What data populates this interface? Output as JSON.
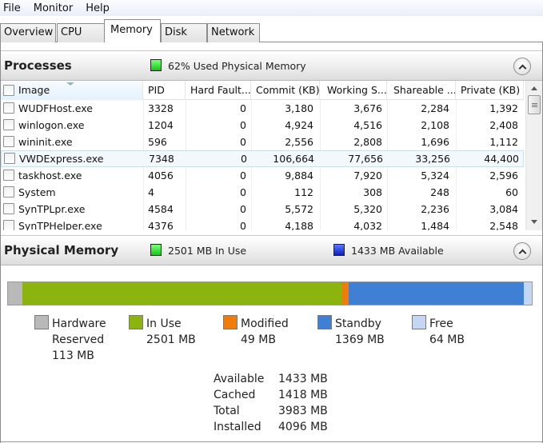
{
  "menu": [
    "File",
    "Monitor",
    "Help"
  ],
  "tabs": [
    {
      "label": "Overview",
      "active": false
    },
    {
      "label": "CPU",
      "active": false
    },
    {
      "label": "Memory",
      "active": true
    },
    {
      "label": "Disk",
      "active": false
    },
    {
      "label": "Network",
      "active": false
    }
  ],
  "processes": {
    "title": "Processes",
    "summary": "62% Used Physical Memory",
    "columns": [
      "Image",
      "PID",
      "Hard Fault...",
      "Commit (KB)",
      "Working S...",
      "Shareable ...",
      "Private (KB)"
    ],
    "rows": [
      {
        "image": "WUDFHost.exe",
        "pid": "3328",
        "hard_faults": "0",
        "commit": "3,180",
        "working_set": "3,676",
        "shareable": "2,284",
        "private": "1,392",
        "selected": false
      },
      {
        "image": "winlogon.exe",
        "pid": "1204",
        "hard_faults": "0",
        "commit": "4,924",
        "working_set": "4,516",
        "shareable": "2,108",
        "private": "2,408",
        "selected": false
      },
      {
        "image": "wininit.exe",
        "pid": "596",
        "hard_faults": "0",
        "commit": "2,556",
        "working_set": "2,808",
        "shareable": "1,696",
        "private": "1,112",
        "selected": false
      },
      {
        "image": "VWDExpress.exe",
        "pid": "7348",
        "hard_faults": "0",
        "commit": "106,664",
        "working_set": "77,656",
        "shareable": "33,256",
        "private": "44,400",
        "selected": true
      },
      {
        "image": "taskhost.exe",
        "pid": "4056",
        "hard_faults": "0",
        "commit": "9,884",
        "working_set": "7,920",
        "shareable": "5,324",
        "private": "2,596",
        "selected": false
      },
      {
        "image": "System",
        "pid": "4",
        "hard_faults": "0",
        "commit": "112",
        "working_set": "308",
        "shareable": "248",
        "private": "60",
        "selected": false
      },
      {
        "image": "SynTPLpr.exe",
        "pid": "4584",
        "hard_faults": "0",
        "commit": "5,572",
        "working_set": "5,320",
        "shareable": "2,236",
        "private": "3,084",
        "selected": false
      },
      {
        "image": "SynTPHelper.exe",
        "pid": "4376",
        "hard_faults": "0",
        "commit": "4,188",
        "working_set": "4,032",
        "shareable": "1,484",
        "private": "2,548",
        "selected": false
      }
    ]
  },
  "physical_memory": {
    "title": "Physical Memory",
    "in_use_text": "2501 MB In Use",
    "available_text": "1433 MB Available",
    "bar": [
      {
        "key": "hardware",
        "mb": 113,
        "color": "#b9b9b9"
      },
      {
        "key": "in_use",
        "mb": 2501,
        "color": "#8bb40e"
      },
      {
        "key": "modified",
        "mb": 49,
        "color": "#f27c0a"
      },
      {
        "key": "standby",
        "mb": 1369,
        "color": "#3f7fd4"
      },
      {
        "key": "free",
        "mb": 64,
        "color": "#c4d6f2"
      }
    ],
    "legend": [
      {
        "label": "Hardware Reserved",
        "label_line1": "Hardware",
        "label_line2": "Reserved",
        "value": "113 MB",
        "color": "#b9b9b9"
      },
      {
        "label": "In Use",
        "value": "2501 MB",
        "color": "#8bb40e"
      },
      {
        "label": "Modified",
        "value": "49 MB",
        "color": "#f27c0a"
      },
      {
        "label": "Standby",
        "value": "1369 MB",
        "color": "#3f7fd4"
      },
      {
        "label": "Free",
        "value": "64 MB",
        "color": "#c4d6f2"
      }
    ],
    "stats": [
      {
        "label": "Available",
        "value": "1433 MB"
      },
      {
        "label": "Cached",
        "value": "1418 MB"
      },
      {
        "label": "Total",
        "value": "3983 MB"
      },
      {
        "label": "Installed",
        "value": "4096 MB"
      }
    ]
  }
}
